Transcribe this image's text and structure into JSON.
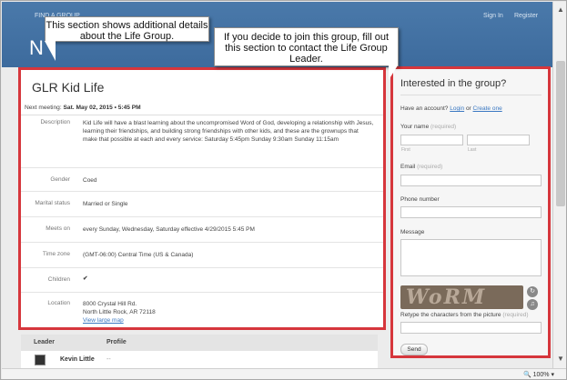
{
  "header": {
    "find_link": "FIND A GROUP",
    "sign_in": "Sign In",
    "register": "Register",
    "heading_initial": "N"
  },
  "callouts": {
    "left": "This section shows additional details about the Life Group.",
    "right": "If you decide to join this group, fill out this section to contact the Life Group Leader."
  },
  "group": {
    "title": "GLR Kid Life",
    "next_meeting_label": "Next meeting:",
    "next_meeting_value": "Sat. May 02, 2015 • 5:45 PM",
    "details": [
      {
        "label": "Description",
        "value": "Kid Life will have a blast learning about the uncompromised Word of God, developing a relationship with Jesus, learning their friendships, and building strong friendships with other kids, and these are the grownups that make that possible at each and every service: Saturday 5:45pm Sunday 9:30am Sunday 11:15am"
      },
      {
        "label": "Gender",
        "value": "Coed"
      },
      {
        "label": "Marital status",
        "value": "Married or Single"
      },
      {
        "label": "Meets on",
        "value": "every Sunday, Wednesday, Saturday effective 4/29/2015 5:45 PM"
      },
      {
        "label": "Time zone",
        "value": "(GMT-06:00) Central Time (US & Canada)"
      },
      {
        "label": "Children",
        "value": "✔"
      },
      {
        "label": "Location",
        "value": "8000 Crystal Hill Rd.",
        "value2": "North Little Rock, AR 72118",
        "link": "View large map"
      }
    ]
  },
  "leaders": {
    "col_leader": "Leader",
    "col_profile": "Profile",
    "rows": [
      {
        "name": "Kevin Little",
        "profile": "--"
      }
    ]
  },
  "form": {
    "title": "Interested in the group?",
    "account_prefix": "Have an account?",
    "login": "Login",
    "or": "or",
    "create": "Create one",
    "name_label": "Your name",
    "required": "(required)",
    "first": "First",
    "last": "Last",
    "email_label": "Email",
    "phone_label": "Phone number",
    "message_label": "Message",
    "captcha_text": "WoRM",
    "retype_label": "Retype the characters from the picture",
    "send": "Send"
  },
  "status": {
    "zoom": "100%"
  }
}
